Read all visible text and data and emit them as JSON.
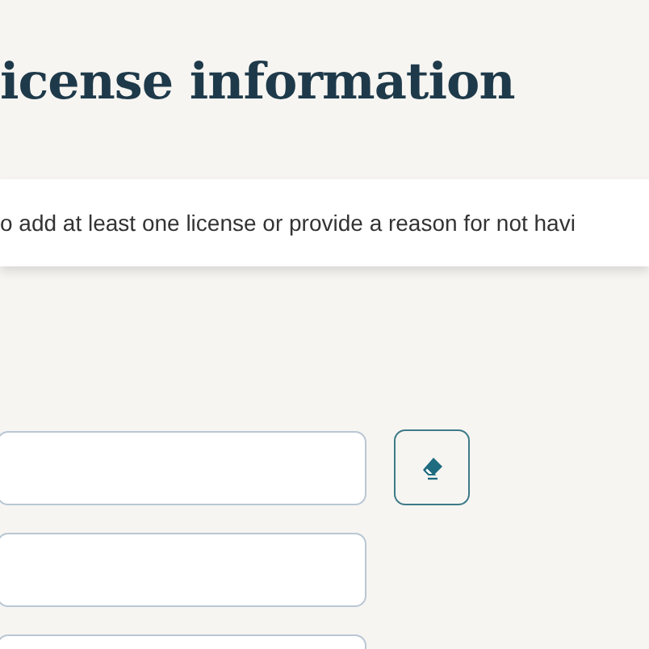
{
  "heading": "icense information",
  "notice": "o add at least one license or provide a reason for not havi",
  "fields": [
    {
      "clear_button": true
    },
    {
      "clear_button": false
    },
    {
      "clear_button": false
    }
  ]
}
